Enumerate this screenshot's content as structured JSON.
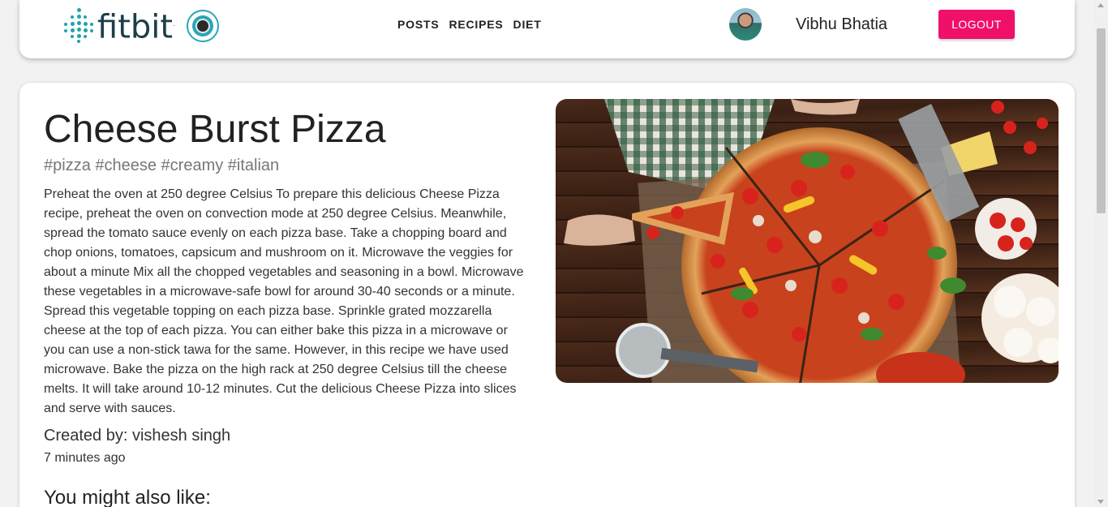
{
  "brand": {
    "name": "fitbit",
    "trademark": ".",
    "accent": "#1fa3ad"
  },
  "nav": {
    "links": [
      "POSTS",
      "RECIPES",
      "DIET"
    ]
  },
  "user": {
    "name": "Vibhu Bhatia",
    "logout_label": "LOGOUT",
    "logout_color": "#f0106a"
  },
  "recipe": {
    "title": "Cheese Burst Pizza",
    "tags": "#pizza #cheese #creamy #italian",
    "description": "Preheat the oven at 250 degree Celsius To prepare this delicious Cheese Pizza recipe, preheat the oven on convection mode at 250 degree Celsius. Meanwhile, spread the tomato sauce evenly on each pizza base. Take a chopping board and chop onions, tomatoes, capsicum and mushroom on it. Microwave the veggies for about a minute Mix all the chopped vegetables and seasoning in a bowl. Microwave these vegetables in a microwave-safe bowl for around 30-40 seconds or a minute. Spread this vegetable topping on each pizza base. Sprinkle grated mozzarella cheese at the top of each pizza. You can either bake this pizza in a microwave or you can use a non-stick tawa for the same. However, in this recipe we have used microwave. Bake the pizza on the high rack at 250 degree Celsius till the cheese melts. It will take around 10-12 minutes. Cut the delicious Cheese Pizza into slices and serve with sauces.",
    "created_by": "Created by: vishesh singh",
    "time_ago": "7 minutes ago",
    "image_icon": "pizza-photo"
  },
  "related": {
    "heading": "You might also like:"
  }
}
